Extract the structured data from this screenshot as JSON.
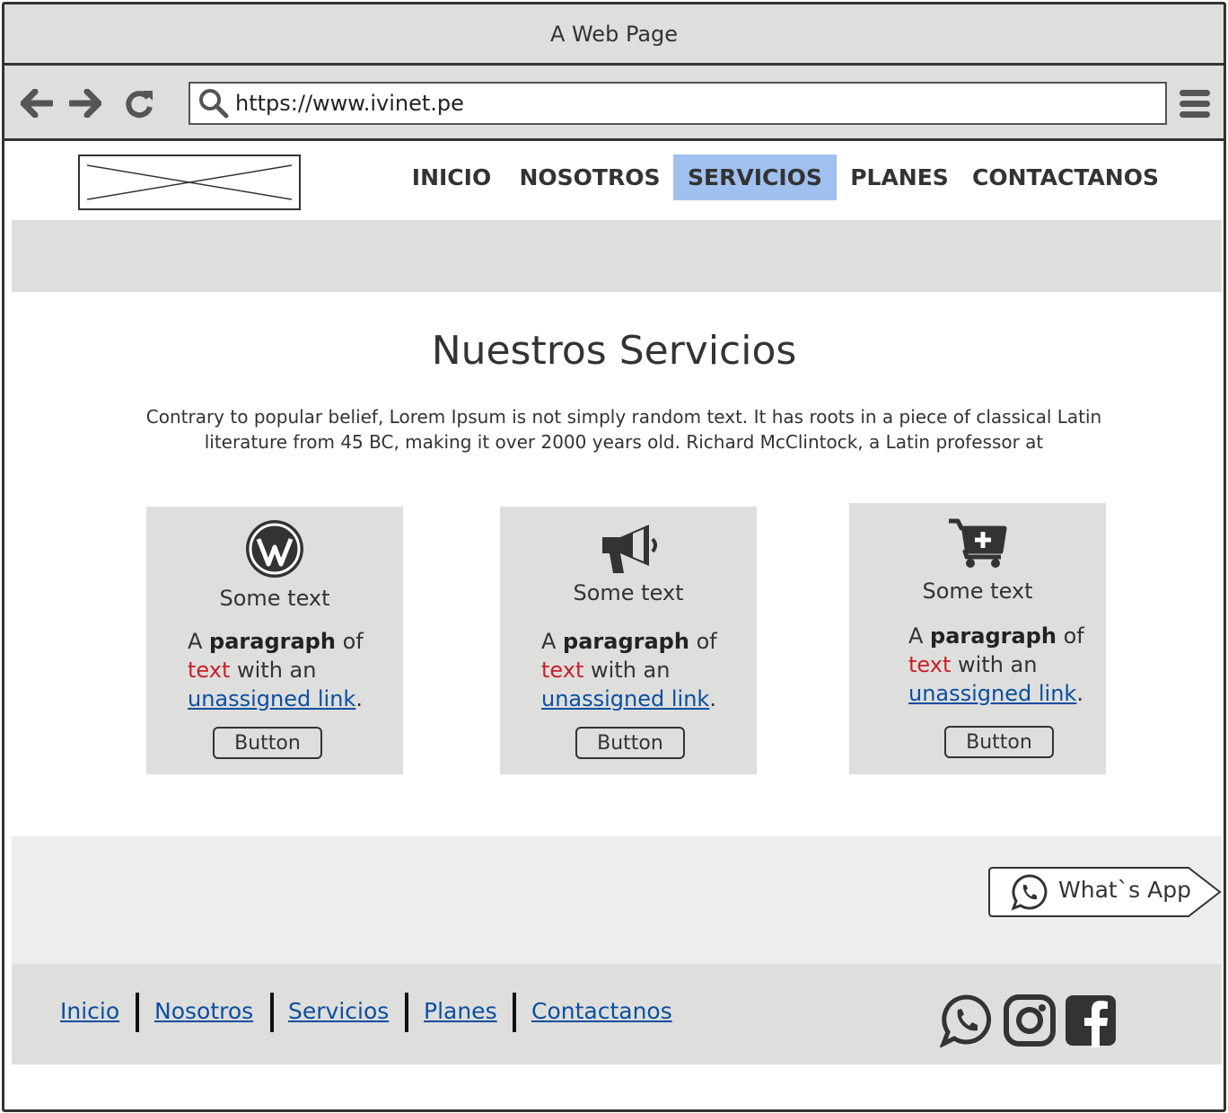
{
  "browser": {
    "window_title": "A Web Page",
    "url": "https://www.ivinet.pe"
  },
  "nav": {
    "items": [
      {
        "label": "INICIO",
        "active": false
      },
      {
        "label": "NOSOTROS",
        "active": false
      },
      {
        "label": "SERVICIOS",
        "active": true
      },
      {
        "label": "PLANES",
        "active": false
      },
      {
        "label": "CONTACTANOS",
        "active": false
      }
    ]
  },
  "main": {
    "title": "Nuestros Servicios",
    "intro_line1": "Contrary to popular belief, Lorem Ipsum is not simply random text. It has roots in a piece of classical Latin",
    "intro_line2": "literature from 45 BC, making it over 2000 years old. Richard McClintock, a Latin professor at"
  },
  "cards": [
    {
      "icon": "wordpress-icon",
      "heading": "Some text",
      "para_a": "A ",
      "para_bold": "paragraph",
      "para_of": " of",
      "para_red": "text",
      "para_with": " with an",
      "para_link": "unassigned link",
      "para_end": ".",
      "button": "Button"
    },
    {
      "icon": "megaphone-icon",
      "heading": "Some text",
      "para_a": "A ",
      "para_bold": "paragraph",
      "para_of": " of",
      "para_red": "text",
      "para_with": " with an",
      "para_link": "unassigned link",
      "para_end": ".",
      "button": "Button"
    },
    {
      "icon": "cart-plus-icon",
      "heading": "Some text",
      "para_a": "A ",
      "para_bold": "paragraph",
      "para_of": " of",
      "para_red": "text",
      "para_with": " with an",
      "para_link": "unassigned link",
      "para_end": ".",
      "button": "Button"
    }
  ],
  "whatsapp_button": {
    "label": "What`s App"
  },
  "footer": {
    "links": [
      "Inicio",
      "Nosotros",
      "Servicios",
      "Planes",
      "Contactanos"
    ],
    "social": [
      "whatsapp-icon",
      "instagram-icon",
      "facebook-icon"
    ]
  },
  "colors": {
    "nav_active": "#a0c0ef",
    "link": "#0b4fa0",
    "red_text": "#c8202a",
    "panel": "#dededc"
  }
}
